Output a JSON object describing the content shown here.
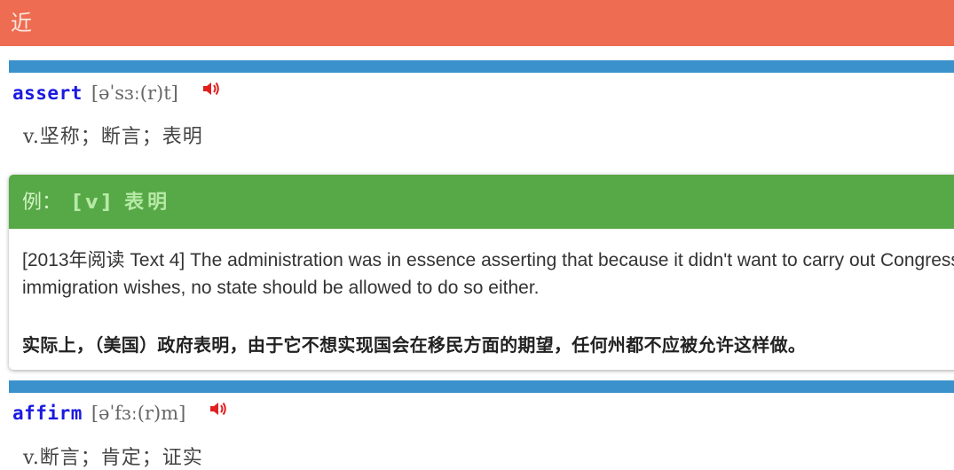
{
  "header": {
    "title": "近"
  },
  "entries": [
    {
      "word": "assert",
      "phonetic": "[əˈsɜː(r)t]",
      "definition": "v.坚称；断言；表明"
    },
    {
      "word": "affirm",
      "phonetic": "[əˈfɜː(r)m]",
      "definition": "v.断言；肯定；证实"
    }
  ],
  "example": {
    "label": "例：",
    "tag": "[v] 表明",
    "english": "[2013年阅读 Text 4] The administration was in essence asserting that because it didn't want to carry out Congress's immigration wishes, no state should be allowed to do so either.",
    "chinese": "实际上，（美国）政府表明，由于它不想实现国会在移民方面的期望，任何州都不应被允许这样做。"
  },
  "icons": {
    "pronounce": "speaker-icon"
  },
  "colors": {
    "header": "#ee6c51",
    "divider": "#3a91cc",
    "example_header": "#57a846",
    "word": "#1a1ae0",
    "speaker": "#e02020"
  }
}
